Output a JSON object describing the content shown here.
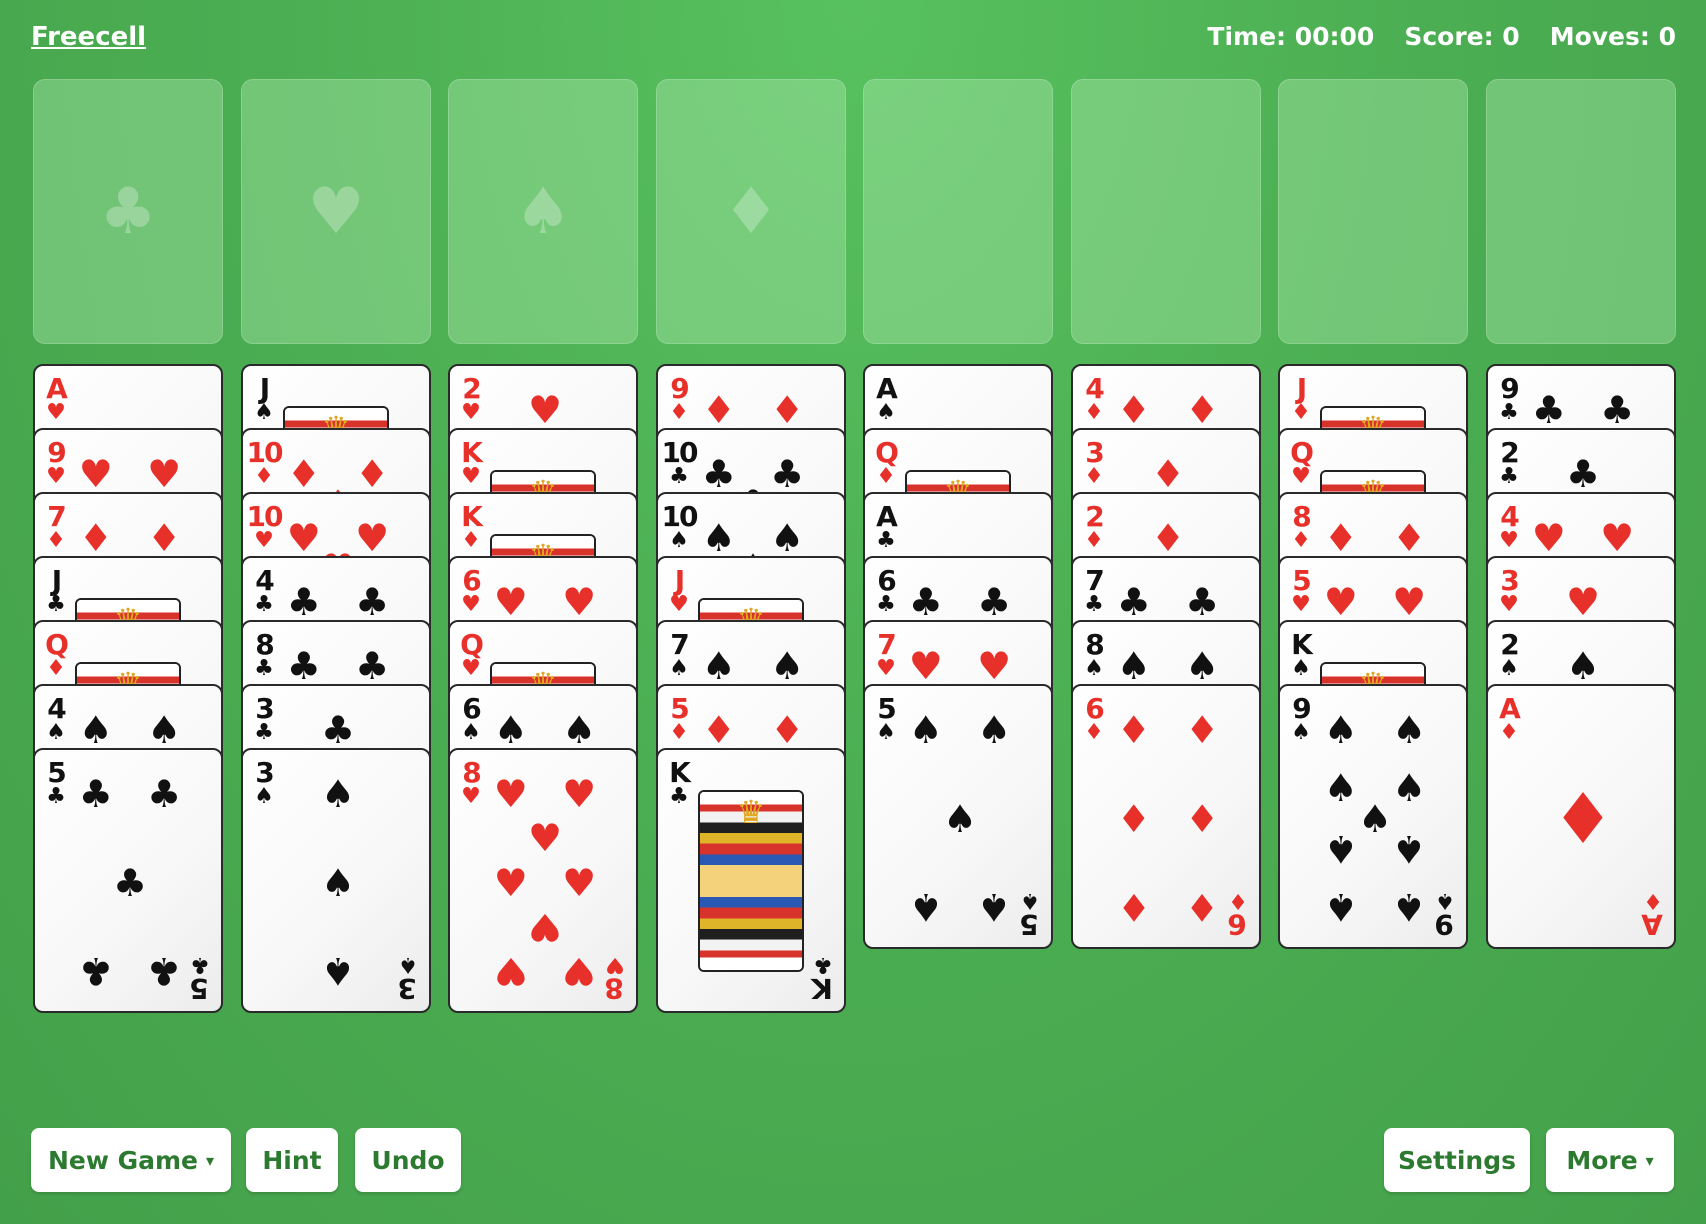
{
  "app": {
    "title": "Freecell",
    "time_label": "Time: 00:00",
    "score_label": "Score: 0",
    "moves_label": "Moves: 0"
  },
  "foundations": [
    {
      "suit": "clubs",
      "icon": "♣"
    },
    {
      "suit": "hearts",
      "icon": "♥"
    },
    {
      "suit": "spades",
      "icon": "♠"
    },
    {
      "suit": "diamonds",
      "icon": "♦"
    }
  ],
  "free_cells": [
    {},
    {},
    {},
    {}
  ],
  "columns": [
    [
      {
        "r": "A",
        "s": "♥"
      },
      {
        "r": "9",
        "s": "♥"
      },
      {
        "r": "7",
        "s": "♦"
      },
      {
        "r": "J",
        "s": "♣"
      },
      {
        "r": "Q",
        "s": "♦"
      },
      {
        "r": "4",
        "s": "♠"
      },
      {
        "r": "5",
        "s": "♣"
      }
    ],
    [
      {
        "r": "J",
        "s": "♠"
      },
      {
        "r": "10",
        "s": "♦"
      },
      {
        "r": "10",
        "s": "♥"
      },
      {
        "r": "4",
        "s": "♣"
      },
      {
        "r": "8",
        "s": "♣"
      },
      {
        "r": "3",
        "s": "♣"
      },
      {
        "r": "3",
        "s": "♠"
      }
    ],
    [
      {
        "r": "2",
        "s": "♥"
      },
      {
        "r": "K",
        "s": "♥"
      },
      {
        "r": "K",
        "s": "♦"
      },
      {
        "r": "6",
        "s": "♥"
      },
      {
        "r": "Q",
        "s": "♥"
      },
      {
        "r": "6",
        "s": "♠"
      },
      {
        "r": "8",
        "s": "♥"
      }
    ],
    [
      {
        "r": "9",
        "s": "♦"
      },
      {
        "r": "10",
        "s": "♣"
      },
      {
        "r": "10",
        "s": "♠"
      },
      {
        "r": "J",
        "s": "♥"
      },
      {
        "r": "7",
        "s": "♠"
      },
      {
        "r": "5",
        "s": "♦"
      },
      {
        "r": "K",
        "s": "♣"
      }
    ],
    [
      {
        "r": "A",
        "s": "♠"
      },
      {
        "r": "Q",
        "s": "♦"
      },
      {
        "r": "A",
        "s": "♣"
      },
      {
        "r": "6",
        "s": "♣"
      },
      {
        "r": "7",
        "s": "♥"
      },
      {
        "r": "5",
        "s": "♠"
      }
    ],
    [
      {
        "r": "4",
        "s": "♦"
      },
      {
        "r": "3",
        "s": "♦"
      },
      {
        "r": "2",
        "s": "♦"
      },
      {
        "r": "7",
        "s": "♣"
      },
      {
        "r": "8",
        "s": "♠"
      },
      {
        "r": "6",
        "s": "♦"
      }
    ],
    [
      {
        "r": "J",
        "s": "♦"
      },
      {
        "r": "Q",
        "s": "♥"
      },
      {
        "r": "8",
        "s": "♦"
      },
      {
        "r": "5",
        "s": "♥"
      },
      {
        "r": "K",
        "s": "♠"
      },
      {
        "r": "9",
        "s": "♠"
      }
    ],
    [
      {
        "r": "9",
        "s": "♣"
      },
      {
        "r": "2",
        "s": "♣"
      },
      {
        "r": "4",
        "s": "♥"
      },
      {
        "r": "3",
        "s": "♥"
      },
      {
        "r": "2",
        "s": "♠"
      },
      {
        "r": "A",
        "s": "♦"
      }
    ]
  ],
  "buttons": {
    "new_game": "New Game",
    "new_game_caret": "▾",
    "hint": "Hint",
    "undo": "Undo",
    "settings": "Settings",
    "more": "More",
    "more_caret": "▾"
  },
  "colors": {
    "felt": "#4caf53",
    "red_suit": "#e8302a",
    "black_suit": "#111111",
    "button_text": "#2b7a2f"
  }
}
